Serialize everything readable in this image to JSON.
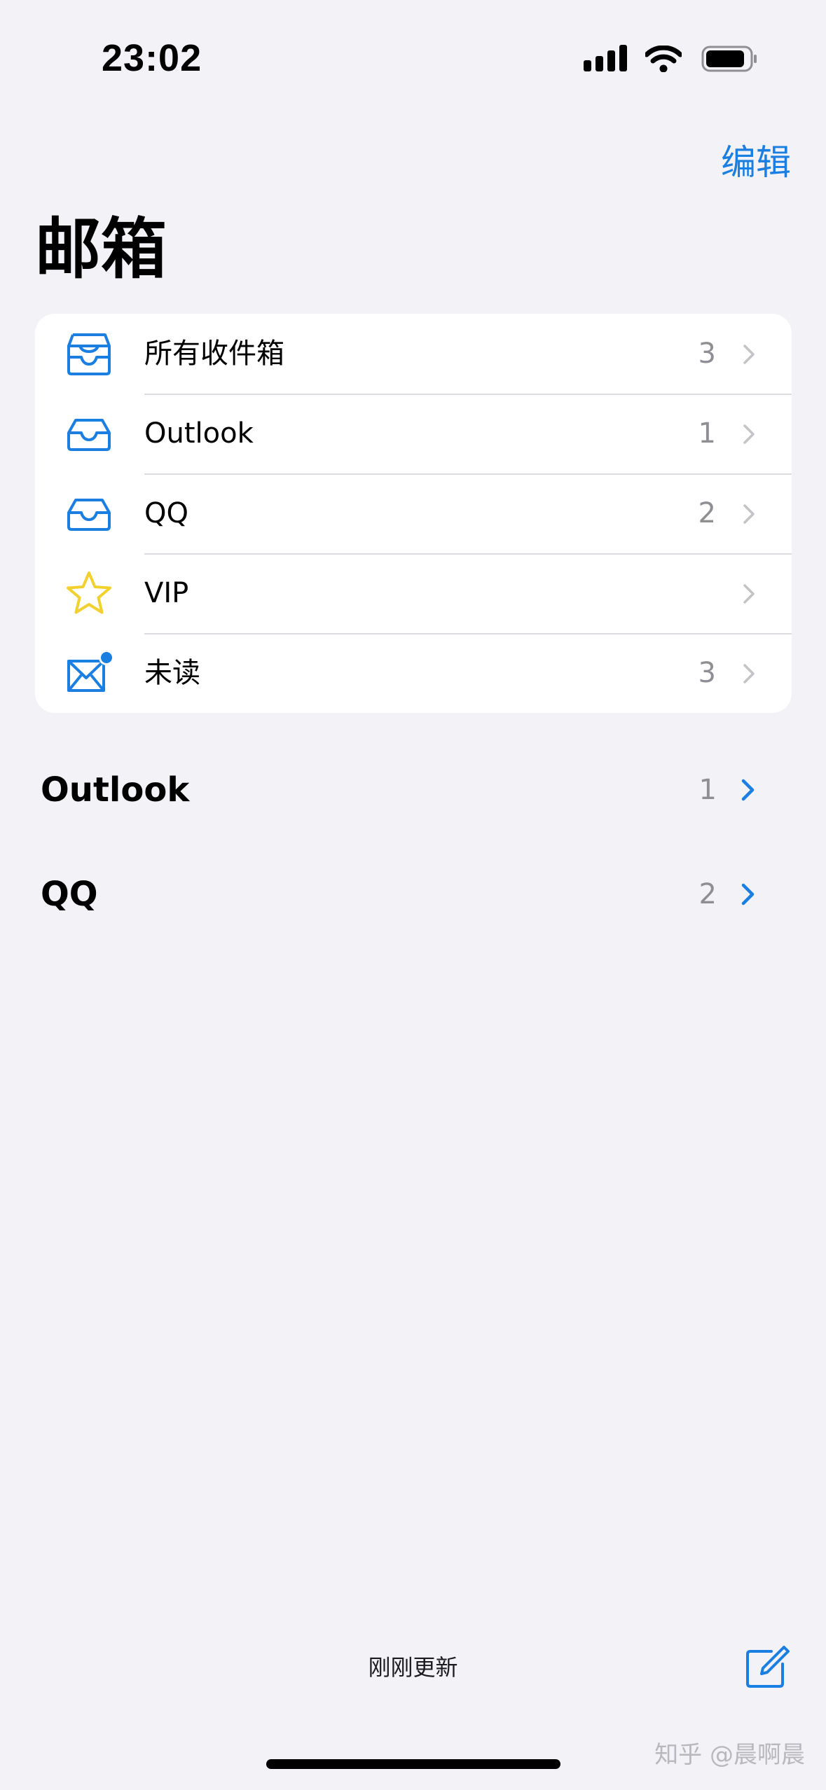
{
  "status_bar": {
    "time": "23:02"
  },
  "nav": {
    "edit_label": "编辑"
  },
  "page": {
    "title": "邮箱"
  },
  "mailboxes": [
    {
      "label": "所有收件箱",
      "count": "3",
      "icon": "tray-stack-icon"
    },
    {
      "label": "Outlook",
      "count": "1",
      "icon": "tray-icon"
    },
    {
      "label": "QQ",
      "count": "2",
      "icon": "tray-icon"
    },
    {
      "label": "VIP",
      "count": "",
      "icon": "star-icon"
    },
    {
      "label": "未读",
      "count": "3",
      "icon": "envelope-badge-icon"
    }
  ],
  "accounts": [
    {
      "name": "Outlook",
      "count": "1"
    },
    {
      "name": "QQ",
      "count": "2"
    }
  ],
  "footer": {
    "update_status": "刚刚更新",
    "watermark": "知乎 @晨啊晨"
  },
  "colors": {
    "accent": "#1a7fe0",
    "star": "#f2d12e",
    "background": "#f2f2f7",
    "secondary_text": "#8e8e93"
  }
}
